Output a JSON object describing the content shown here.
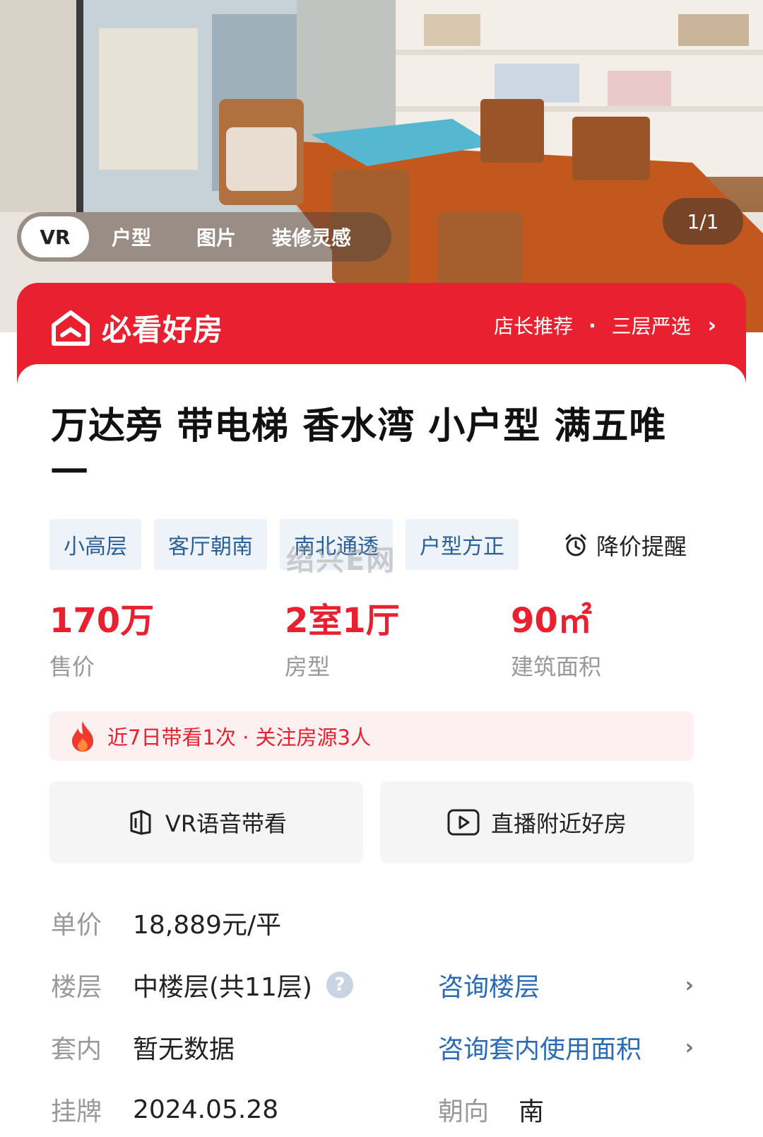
{
  "media": {
    "tabs": [
      "VR",
      "户型",
      "图片",
      "装修灵感"
    ],
    "counter": "1/1"
  },
  "banner": {
    "brand": "必看好房",
    "right_a": "店长推荐",
    "sep": "·",
    "right_b": "三层严选",
    "chevron": "›"
  },
  "listing": {
    "title": "万达旁 带电梯 香水湾 小户型 满五唯一",
    "tags": [
      "小高层",
      "客厅朝南",
      "南北通透",
      "户型方正"
    ],
    "price_alert": "降价提醒",
    "stats": [
      {
        "value": "170万",
        "label": "售价"
      },
      {
        "value": "2室1厅",
        "label": "房型"
      },
      {
        "value": "90㎡",
        "label": "建筑面积"
      }
    ],
    "hot_text": "近7日带看1次 · 关注房源3人"
  },
  "actions": {
    "vr_label": "VR语音带看",
    "live_label": "直播附近好房"
  },
  "details": {
    "unit_price_k": "单价",
    "unit_price_v": "18,889元/平",
    "floor_k": "楼层",
    "floor_v": "中楼层(共11层)",
    "floor_help": "?",
    "floor_link": "咨询楼层",
    "inner_k": "套内",
    "inner_v": "暂无数据",
    "inner_link": "咨询套内使用面积",
    "listed_k": "挂牌",
    "listed_v": "2024.05.28",
    "orient_k": "朝向",
    "orient_v": "南",
    "chevron": "›"
  },
  "watermark": "绍兴E网",
  "colors": {
    "brand_red": "#e8202f",
    "link_blue": "#2a6bb8",
    "tag_blue": "#2a5f98"
  }
}
